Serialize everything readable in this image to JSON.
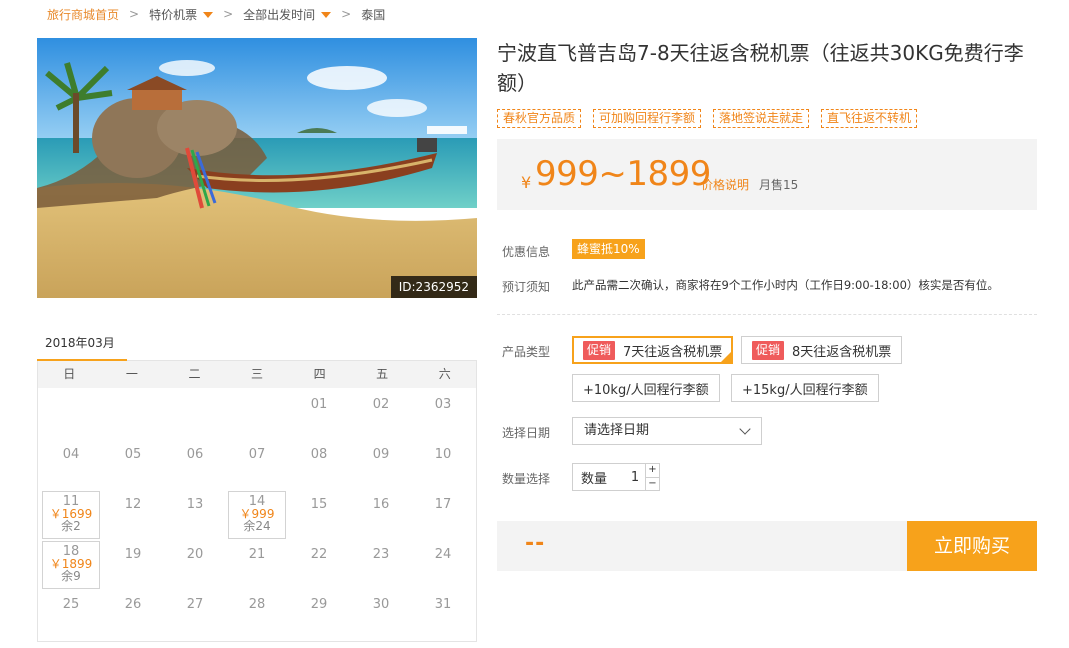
{
  "breadcrumb": {
    "home": "旅行商城首页",
    "items": [
      {
        "label": "特价机票",
        "dropdown": true
      },
      {
        "label": "全部出发时间",
        "dropdown": true
      },
      {
        "label": "泰国",
        "dropdown": false
      }
    ]
  },
  "hero": {
    "image_id": "ID:2362952"
  },
  "calendar": {
    "month": "2018年03月",
    "weekdays": [
      "日",
      "一",
      "二",
      "三",
      "四",
      "五",
      "六"
    ],
    "leading_blanks": 4,
    "days": [
      {
        "day": "01"
      },
      {
        "day": "02"
      },
      {
        "day": "03"
      },
      {
        "day": "04"
      },
      {
        "day": "05"
      },
      {
        "day": "06"
      },
      {
        "day": "07"
      },
      {
        "day": "08"
      },
      {
        "day": "09"
      },
      {
        "day": "10"
      },
      {
        "day": "11",
        "price": "￥1699",
        "stock": "余2"
      },
      {
        "day": "12"
      },
      {
        "day": "13"
      },
      {
        "day": "14",
        "price": "￥999",
        "stock": "余24"
      },
      {
        "day": "15"
      },
      {
        "day": "16"
      },
      {
        "day": "17"
      },
      {
        "day": "18",
        "price": "￥1899",
        "stock": "余9"
      },
      {
        "day": "19"
      },
      {
        "day": "20"
      },
      {
        "day": "21"
      },
      {
        "day": "22"
      },
      {
        "day": "23"
      },
      {
        "day": "24"
      },
      {
        "day": "25"
      },
      {
        "day": "26"
      },
      {
        "day": "27"
      },
      {
        "day": "28"
      },
      {
        "day": "29"
      },
      {
        "day": "30"
      },
      {
        "day": "31"
      }
    ]
  },
  "product": {
    "title": "宁波直飞普吉岛7-8天往返含税机票（往返共30KG免费行李额）",
    "tags": [
      "春秋官方品质",
      "可加购回程行李额",
      "落地签说走就走",
      "直飞往返不转机"
    ],
    "currency": "¥",
    "price": "999~1899",
    "price_note": "价格说明",
    "sold": "月售15"
  },
  "info": {
    "promo_label": "优惠信息",
    "promo_badge": "蜂蜜抵10%",
    "notice_label": "预订须知",
    "notice_text": "此产品需二次确认，商家将在9个工作小时内（工作日9:00-18:00）核实是否有位。"
  },
  "options": {
    "type_label": "产品类型",
    "types": [
      {
        "promo": "促销",
        "label": "7天往返含税机票",
        "selected": true
      },
      {
        "promo": "促销",
        "label": "8天往返含税机票",
        "selected": false
      }
    ],
    "addons": [
      "+10kg/人回程行李额",
      "+15kg/人回程行李额"
    ],
    "date_label": "选择日期",
    "date_placeholder": "请选择日期",
    "qty_label": "数量选择",
    "qty_field_label": "数量",
    "qty_value": "1",
    "qty_plus": "+",
    "qty_minus": "−"
  },
  "buy": {
    "total": "--",
    "button": "立即购买"
  },
  "colors": {
    "accent": "#f7a21b",
    "price": "#f08519",
    "promo_red": "#ef5b5b"
  }
}
